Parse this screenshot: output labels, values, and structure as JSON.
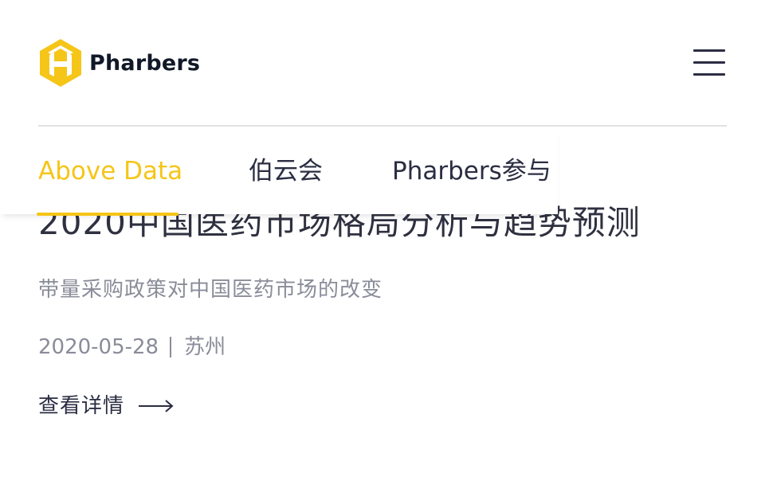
{
  "brand": {
    "name": "Pharbers",
    "accent_color": "#f5c518",
    "logo_icon": "pharbers-logo-mark"
  },
  "header": {
    "menu_icon": "hamburger-menu-icon"
  },
  "tabs": [
    {
      "label": "Above Data",
      "active": true
    },
    {
      "label": "伯云会",
      "active": false
    },
    {
      "label": "Pharbers参与",
      "active": false
    }
  ],
  "article": {
    "title": "2020中国医药市场格局分析与趋势预测",
    "subtitle": "带量采购政策对中国医药市场的改变",
    "date": "2020-05-28",
    "location": "苏州",
    "link_label": "查看详情",
    "link_icon": "arrow-right-icon"
  }
}
